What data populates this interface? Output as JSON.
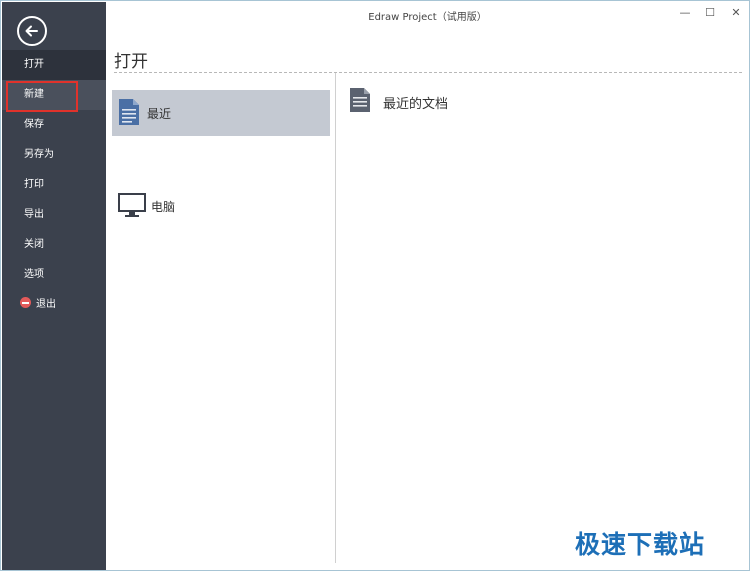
{
  "window": {
    "title": "Edraw Project（试用版）"
  },
  "window_controls": {
    "minimize": "—",
    "maximize": "☐",
    "close": "✕"
  },
  "sidebar": {
    "back": "back-arrow",
    "items": [
      {
        "label": "打开"
      },
      {
        "label": "新建"
      },
      {
        "label": "保存"
      },
      {
        "label": "另存为"
      },
      {
        "label": "打印"
      },
      {
        "label": "导出"
      },
      {
        "label": "关闭"
      },
      {
        "label": "选项"
      },
      {
        "label": "退出"
      }
    ]
  },
  "main": {
    "title": "打开",
    "locations": [
      {
        "label": "最近",
        "icon": "document-icon"
      },
      {
        "label": "电脑",
        "icon": "monitor-icon"
      }
    ],
    "recent": {
      "title": "最近的文档",
      "icon": "document-icon"
    }
  },
  "watermark": "极速下载站",
  "colors": {
    "sidebar": "#3b414d",
    "selected_location": "#c4c9d2",
    "highlight_box": "#e0322b",
    "watermark": "#1d6fb7"
  }
}
